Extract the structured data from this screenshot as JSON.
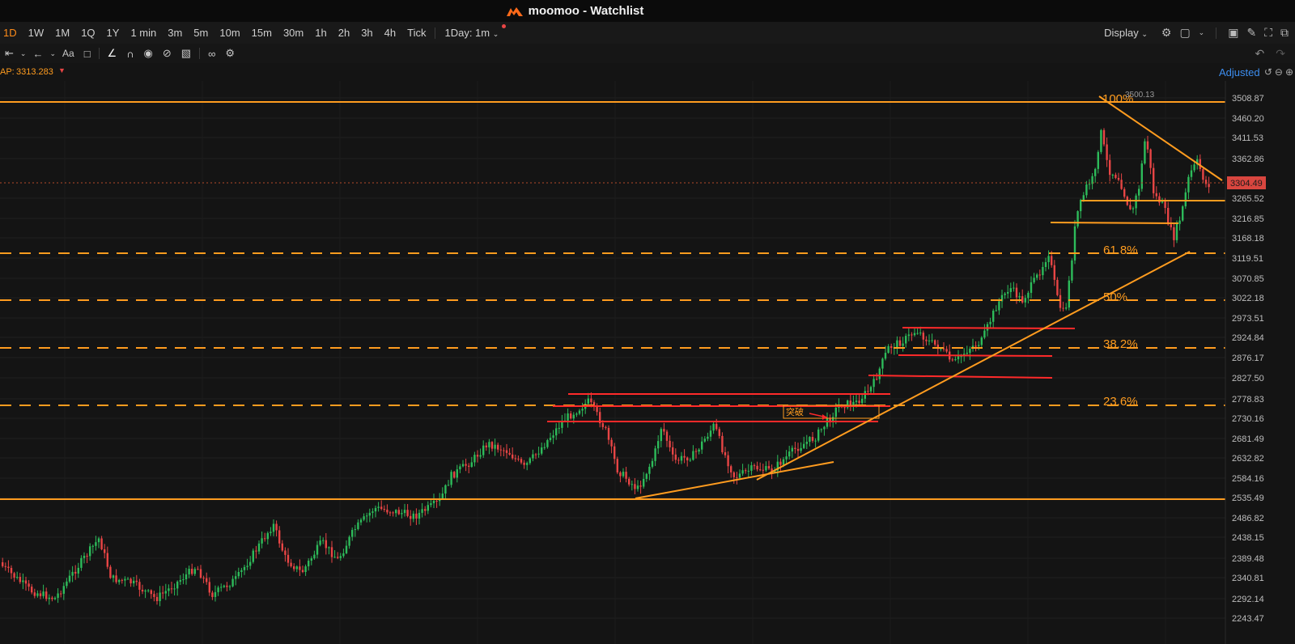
{
  "window": {
    "app_name": "moomoo",
    "separator": "-",
    "page": "Watchlist",
    "title": "moomoo - Watchlist"
  },
  "timeframes": [
    "1D",
    "1W",
    "1M",
    "1Q",
    "1Y",
    "1 min",
    "3m",
    "5m",
    "10m",
    "15m",
    "30m",
    "1h",
    "2h",
    "3h",
    "4h",
    "Tick"
  ],
  "active_timeframe": "1D",
  "interval_select": "1Day: 1m",
  "display_label": "Display",
  "drawing_tools": [
    "hline-icon",
    "arrow-left-icon",
    "text-icon",
    "comment-icon",
    "line-icon",
    "magnet-icon",
    "eye-icon",
    "hide-icon",
    "trash-icon",
    "link-icon",
    "settings-icon"
  ],
  "indicator": {
    "label": "AP:",
    "value": "3313.283"
  },
  "adjusted_label": "Adjusted",
  "price_axis": {
    "ticks": [
      "3508.87",
      "3460.20",
      "3411.53",
      "3362.86",
      "3265.52",
      "3216.85",
      "3168.18",
      "3119.51",
      "3070.85",
      "3022.18",
      "2973.51",
      "2924.84",
      "2876.17",
      "2827.50",
      "2778.83",
      "2730.16",
      "2681.49",
      "2632.82",
      "2584.16",
      "2535.49",
      "2486.82",
      "2438.15",
      "2389.48",
      "2340.81",
      "2292.14",
      "2243.47"
    ],
    "current_price": "3304.49",
    "current_price_color": "#d9463f",
    "high_label": "3500.13"
  },
  "fibonacci": [
    "100%",
    "61.8%",
    "50%",
    "38.2%",
    "23.6%"
  ],
  "annotation": "突破",
  "colors": {
    "up": "#2dbb5a",
    "down": "#e84545",
    "fib": "#ff9c1f",
    "support": "#ff2a2a",
    "accent": "#ff8c1a",
    "link": "#3d8ef0"
  }
}
